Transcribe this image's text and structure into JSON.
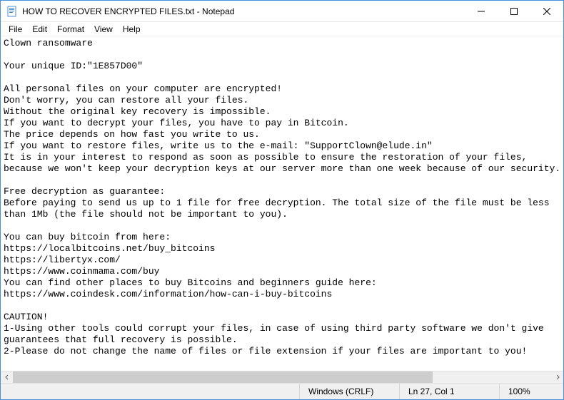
{
  "titlebar": {
    "title": "HOW TO RECOVER ENCRYPTED FILES.txt - Notepad"
  },
  "menu": {
    "file": "File",
    "edit": "Edit",
    "format": "Format",
    "view": "View",
    "help": "Help"
  },
  "content": "Clown ransomware\n\nYour unique ID:\"1E857D00\"\n\nAll personal files on your computer are encrypted!\nDon't worry, you can restore all your files.\nWithout the original key recovery is impossible.\nIf you want to decrypt your files, you have to pay in Bitcoin.\nThe price depends on how fast you write to us.\nIf you want to restore files, write us to the e-mail: \"SupportClown@elude.in\"\nIt is in your interest to respond as soon as possible to ensure the restoration of your files,\nbecause we won't keep your decryption keys at our server more than one week because of our security.\n\nFree decryption as guarantee:\nBefore paying to send us up to 1 file for free decryption. The total size of the file must be less\nthan 1Mb (the file should not be important to you).\n\nYou can buy bitcoin from here:\nhttps://localbitcoins.net/buy_bitcoins\nhttps://libertyx.com/\nhttps://www.coinmama.com/buy\nYou can find other places to buy Bitcoins and beginners guide here:\nhttps://www.coindesk.com/information/how-can-i-buy-bitcoins\n\nCAUTION!\n1-Using other tools could corrupt your files, in case of using third party software we don't give\nguarantees that full recovery is possible.\n2-Please do not change the name of files or file extension if your files are important to you!",
  "status": {
    "eol": "Windows (CRLF)",
    "pos": "Ln 27, Col 1",
    "zoom": "100%"
  }
}
